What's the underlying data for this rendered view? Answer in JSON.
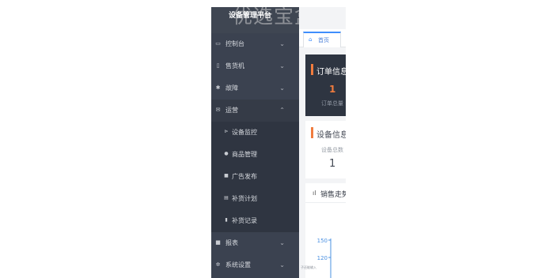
{
  "brand": {
    "title": "设备管理平台",
    "watermark": "优选宝盒"
  },
  "sidebar": {
    "items": [
      {
        "label": "控制台",
        "icon": "monitor-icon",
        "caret": "⌄"
      },
      {
        "label": "售货机",
        "icon": "phone-icon",
        "caret": "⌄"
      },
      {
        "label": "故障",
        "icon": "wrench-icon",
        "caret": "⌄"
      },
      {
        "label": "运营",
        "icon": "mail-icon",
        "caret": "⌃"
      },
      {
        "label": "报表",
        "icon": "table-icon",
        "caret": "⌄"
      },
      {
        "label": "系统设置",
        "icon": "gear-icon",
        "caret": "⌄"
      }
    ],
    "sub_items": [
      {
        "label": "设备监控",
        "icon": "monitor-icon"
      },
      {
        "label": "商品管理",
        "icon": "circle-icon"
      },
      {
        "label": "广告发布",
        "icon": "square-icon"
      },
      {
        "label": "补货计划",
        "icon": "calendar-icon"
      },
      {
        "label": "补货记录",
        "icon": "file-icon"
      }
    ]
  },
  "tabs": [
    {
      "label": "首页",
      "icon": "home-icon"
    }
  ],
  "order_info": {
    "title": "订单信息",
    "value": "1",
    "label": "订单总量"
  },
  "device_info": {
    "title": "设备信息",
    "label": "设备总数",
    "value": "1"
  },
  "sales": {
    "title": "销售走势",
    "icon": "bar-chart-icon"
  },
  "footnote": "子还能输入",
  "chart_data": {
    "type": "line",
    "title": "销售走势",
    "y_ticks": [
      150,
      120
    ],
    "xlabel": "",
    "ylabel": ""
  },
  "colors": {
    "accent": "#f07c3e",
    "sidebar": "#3b4250",
    "tab_active": "#3f8efc",
    "axis": "#4a90e2"
  }
}
